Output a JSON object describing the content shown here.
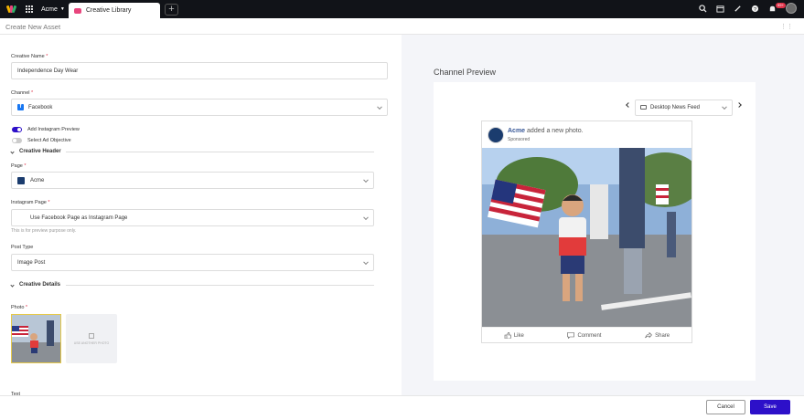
{
  "topbar": {
    "account": "Acme",
    "tab_label": "Creative Library",
    "notification_count": "99+"
  },
  "header": {
    "title": "Create New Asset"
  },
  "form": {
    "creative_name_label": "Creative Name",
    "creative_name_value": "Independence Day Wear",
    "channel_label": "Channel",
    "channel_value": "Facebook",
    "add_instagram_label": "Add Instagram Preview",
    "select_objective_label": "Select Ad Objective",
    "creative_header_label": "Creative Header",
    "page_label": "Page",
    "page_value": "Acme",
    "instagram_page_label": "Instagram Page",
    "instagram_page_value": "Use Facebook Page as Instagram Page",
    "instagram_hint": "This is for preview purpose only.",
    "post_type_label": "Post Type",
    "post_type_value": "Image Post",
    "creative_details_label": "Creative Details",
    "photo_label": "Photo",
    "add_photo_label": "USE ANOTHER PHOTO",
    "text_label": "Text",
    "required_mark": "*"
  },
  "preview": {
    "title": "Channel Preview",
    "device": "Desktop News Feed",
    "page_name": "Acme",
    "action_text": "added a new photo.",
    "sponsored": "Sponsored",
    "like": "Like",
    "comment": "Comment",
    "share": "Share"
  },
  "footer": {
    "cancel_label": "Cancel",
    "save_label": "Save"
  },
  "colors": {
    "primary": "#2d10c9",
    "toggle_on": "#2d10c9",
    "facebook_blue": "#1877f2",
    "required": "#e0344b"
  }
}
